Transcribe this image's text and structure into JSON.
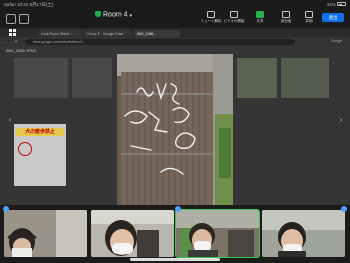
{
  "status_bar": {
    "left": "Safari  10:23  9月17日(土)",
    "battery": "34%"
  },
  "meeting": {
    "room_name": "Room 4",
    "leave_label": "退出",
    "toolbar": [
      {
        "label": "ミュート解除",
        "icon": "microphone-muted-icon"
      },
      {
        "label": "ビデオの開始",
        "icon": "video-off-icon"
      },
      {
        "label": "共有",
        "icon": "share-screen-icon",
        "active": true
      },
      {
        "label": "参加者",
        "icon": "participants-icon"
      },
      {
        "label": "詳細",
        "icon": "more-icon"
      }
    ]
  },
  "browser": {
    "tabs": [
      "Look Room Sheet...",
      "Group F - Google Drive",
      "IMG_1066..."
    ],
    "url": "drive.google.com/drive/folders/1...",
    "profile": "Google",
    "file_name": "IMG_1066 JPEG",
    "poster_text": "犬の散歩禁止"
  },
  "colors": {
    "leave_button": "#0e71eb",
    "share_active": "#23b14d",
    "speaking_outline": "#3cc24f"
  }
}
